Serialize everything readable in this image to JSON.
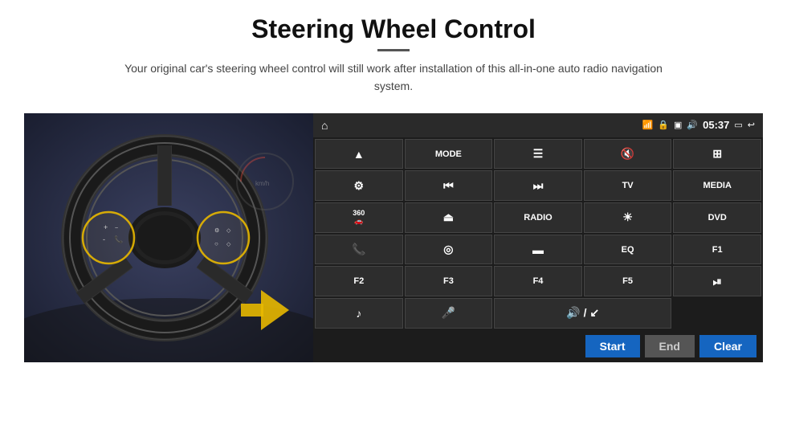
{
  "header": {
    "title": "Steering Wheel Control",
    "subtitle": "Your original car's steering wheel control will still work after installation of this all-in-one auto radio navigation system."
  },
  "status_bar": {
    "time": "05:37"
  },
  "button_grid": [
    [
      {
        "label": "▲",
        "type": "icon",
        "id": "nav-icon"
      },
      {
        "label": "MODE",
        "type": "text",
        "id": "mode-btn"
      },
      {
        "label": "≡",
        "type": "icon",
        "id": "list-icon"
      },
      {
        "label": "🔇",
        "type": "icon",
        "id": "mute-icon"
      },
      {
        "label": "⊞",
        "type": "icon",
        "id": "apps-icon"
      }
    ],
    [
      {
        "label": "⊙",
        "type": "icon",
        "id": "settings-icon"
      },
      {
        "label": "⏮",
        "type": "icon",
        "id": "prev-btn"
      },
      {
        "label": "⏭",
        "type": "icon",
        "id": "next-btn"
      },
      {
        "label": "TV",
        "type": "text",
        "id": "tv-btn"
      },
      {
        "label": "MEDIA",
        "type": "text",
        "id": "media-btn"
      }
    ],
    [
      {
        "label": "360",
        "type": "text",
        "id": "360-btn"
      },
      {
        "label": "▲",
        "type": "icon",
        "id": "eject-btn"
      },
      {
        "label": "RADIO",
        "type": "text",
        "id": "radio-btn"
      },
      {
        "label": "☀",
        "type": "icon",
        "id": "brightness-btn"
      },
      {
        "label": "DVD",
        "type": "text",
        "id": "dvd-btn"
      }
    ],
    [
      {
        "label": "📞",
        "type": "icon",
        "id": "phone-btn"
      },
      {
        "label": "◎",
        "type": "icon",
        "id": "nav2-btn"
      },
      {
        "label": "▬",
        "type": "icon",
        "id": "screen-btn"
      },
      {
        "label": "EQ",
        "type": "text",
        "id": "eq-btn"
      },
      {
        "label": "F1",
        "type": "text",
        "id": "f1-btn"
      }
    ],
    [
      {
        "label": "F2",
        "type": "text",
        "id": "f2-btn"
      },
      {
        "label": "F3",
        "type": "text",
        "id": "f3-btn"
      },
      {
        "label": "F4",
        "type": "text",
        "id": "f4-btn"
      },
      {
        "label": "F5",
        "type": "text",
        "id": "f5-btn"
      },
      {
        "label": "⏯",
        "type": "icon",
        "id": "playpause-btn"
      }
    ],
    [
      {
        "label": "♪",
        "type": "icon",
        "id": "music-btn"
      },
      {
        "label": "🎤",
        "type": "icon",
        "id": "mic-btn"
      },
      {
        "label": "🔊",
        "type": "icon",
        "id": "vol-btn"
      },
      {
        "label": "",
        "type": "empty",
        "id": "empty1"
      },
      {
        "label": "",
        "type": "empty",
        "id": "empty2"
      }
    ]
  ],
  "bottom_bar": {
    "start_label": "Start",
    "end_label": "End",
    "clear_label": "Clear"
  }
}
